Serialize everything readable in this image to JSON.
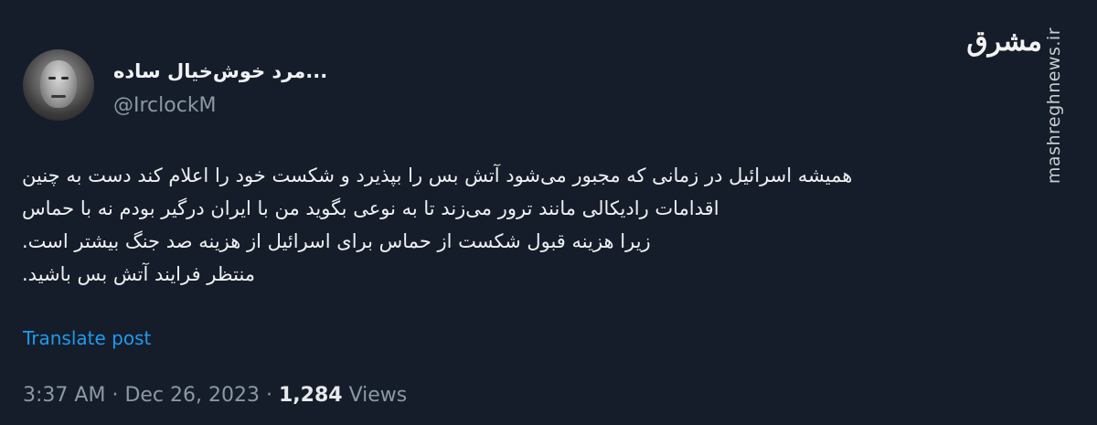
{
  "author": {
    "display_name": "...مرد خوش‌خیال ساده",
    "handle": "@IrclockM"
  },
  "tweet": {
    "lines": [
      "همیشه اسرائیل در زمانی که مجبور می‌شود آتش بس را بپذیرد و شکست خود را اعلام کند دست به چنین",
      "اقدامات رادیکالی مانند ترور می‌زند تا به نوعی بگوید من با ایران درگیر بودم نه با حماس",
      "زیرا هزینه قبول شکست از حماس برای اسرائیل  از هزینه صد جنگ بیشتر است.",
      "منتظر فرایند آتش بس باشید."
    ]
  },
  "translate_label": "Translate post",
  "meta": {
    "time": "3:37 AM",
    "separator": "·",
    "date": "Dec 26, 2023",
    "views_count": "1,284",
    "views_label": "Views"
  },
  "branding": {
    "logo_text": "مشرق",
    "watermark": "mashreghnews.ir"
  },
  "colors": {
    "background": "#161d2a",
    "text": "#e7e9ea",
    "muted": "#8b98a5",
    "link": "#1d9bf0"
  }
}
